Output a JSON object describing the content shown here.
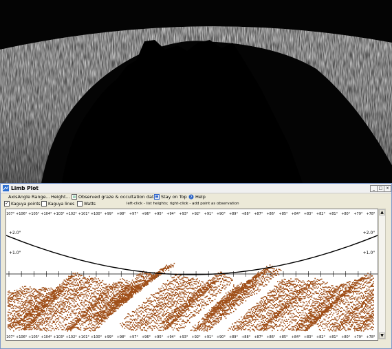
{
  "window": {
    "title": "Limb Plot",
    "controls": {
      "minimize": "_",
      "restore": "□",
      "close": "×"
    }
  },
  "menu": {
    "axis": "AxisAngle Range...",
    "height": "Height...",
    "observed": "Observed graze & occultation data",
    "stay_on_top": "Stay on Top",
    "help": "Help"
  },
  "options": {
    "kaguya_points": {
      "label": "Kaguya points",
      "checked": true
    },
    "kaguya_lines": {
      "label": "Kaguya lines",
      "checked": false
    },
    "watts": {
      "label": "Watts",
      "checked": false
    },
    "hint": "left-click - list heights;   right-click - add point as observation"
  },
  "plot": {
    "top_ticks": [
      "+107°",
      "+106°",
      "+105°",
      "+104°",
      "+103°",
      "+102°",
      "+101°",
      "+100°",
      "+99°",
      "+98°",
      "+97°",
      "+96°",
      "+95°",
      "+94°",
      "+93°",
      "+92°",
      "+91°",
      "+90°",
      "+89°",
      "+88°",
      "+87°",
      "+86°",
      "+85°",
      "+84°",
      "+83°",
      "+82°",
      "+81°",
      "+80°",
      "+79°",
      "+78°"
    ],
    "bottom_ticks": [
      "+107°",
      "+106°",
      "+105°",
      "+104°",
      "+103°",
      "+102°",
      "+101°",
      "+100°",
      "+99°",
      "+98°",
      "+97°",
      "+96°",
      "+95°",
      "+94°",
      "+93°",
      "+92°",
      "+91°",
      "+90°",
      "+89°",
      "+88°",
      "+87°",
      "+86°",
      "+85°",
      "+84°",
      "+83°",
      "+82°",
      "+81°",
      "+80°",
      "+79°",
      "+78°"
    ],
    "left_labels": [
      "+2.0\"",
      "+1.0\""
    ],
    "right_labels": [
      "+2.0\"",
      "+1.0\""
    ],
    "colors": {
      "points": "#a0501a",
      "curve": "#000000"
    }
  }
}
